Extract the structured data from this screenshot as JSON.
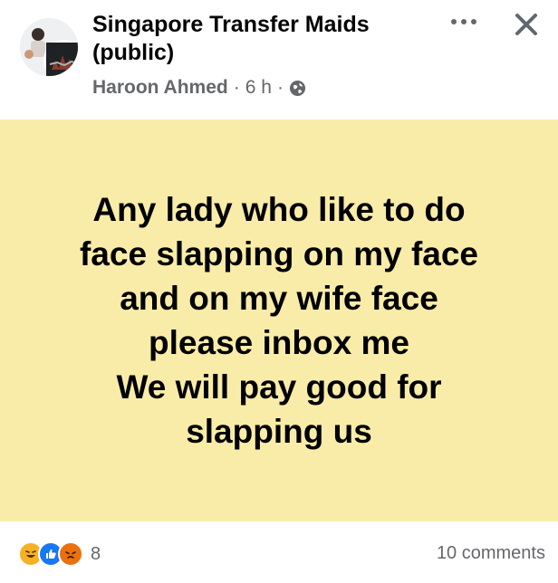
{
  "header": {
    "group_name": "Singapore Transfer Maids (public)",
    "author": "Haroon Ahmed",
    "separator": "·",
    "time": "6 h",
    "privacy_icon": "globe-icon",
    "more_icon": "more-options-icon",
    "close_icon": "close-icon"
  },
  "post": {
    "background_color": "#f8eca8",
    "text": "Any lady who like to do\nface slapping on my face\nand on my wife face\nplease inbox me\nWe will pay good for\nslapping us"
  },
  "footer": {
    "reactions": [
      "haha-reaction-icon",
      "like-reaction-icon",
      "angry-reaction-icon"
    ],
    "reaction_count": "8",
    "comments": "10 comments"
  }
}
